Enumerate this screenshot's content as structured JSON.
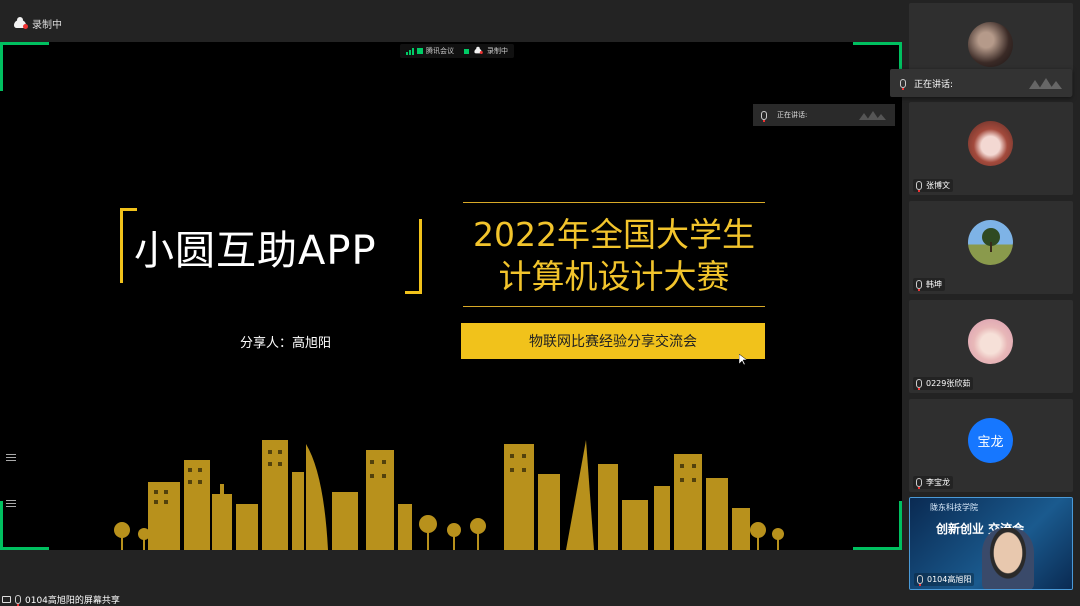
{
  "app": {
    "recording_label": "录制中"
  },
  "inner_status": {
    "app_label": "腾讯会议",
    "recording_label": "录制中"
  },
  "screen_speaking": {
    "label": "正在讲话:"
  },
  "slide": {
    "app_title": "小圆互助APP",
    "title_line1": "2022年全国大学生",
    "title_line2": "计算机设计大赛",
    "presenter": "分享人：高旭阳",
    "subtitle": "物联网比赛经验分享交流会"
  },
  "speaking_popup": {
    "label": "正在讲话:"
  },
  "participants": [
    {
      "name": "",
      "avatar": "photo-dark"
    },
    {
      "name": "张博文",
      "avatar": "photo-anime"
    },
    {
      "name": "韩坤",
      "avatar": "photo-tree"
    },
    {
      "name": "0229张欣茹",
      "avatar": "photo-girl"
    },
    {
      "name": "李宝龙",
      "avatar": "initials",
      "initials": "宝龙"
    },
    {
      "name": "0104高旭阳",
      "avatar": "video",
      "video_banner": "创新创业 交流会",
      "video_org": "陇东科技学院"
    }
  ],
  "bottom": {
    "share_label": "0104高旭阳的屏幕共享"
  },
  "colors": {
    "accent_green": "#00c060",
    "gold": "#f1c21b",
    "avatar_blue": "#1677ff"
  }
}
